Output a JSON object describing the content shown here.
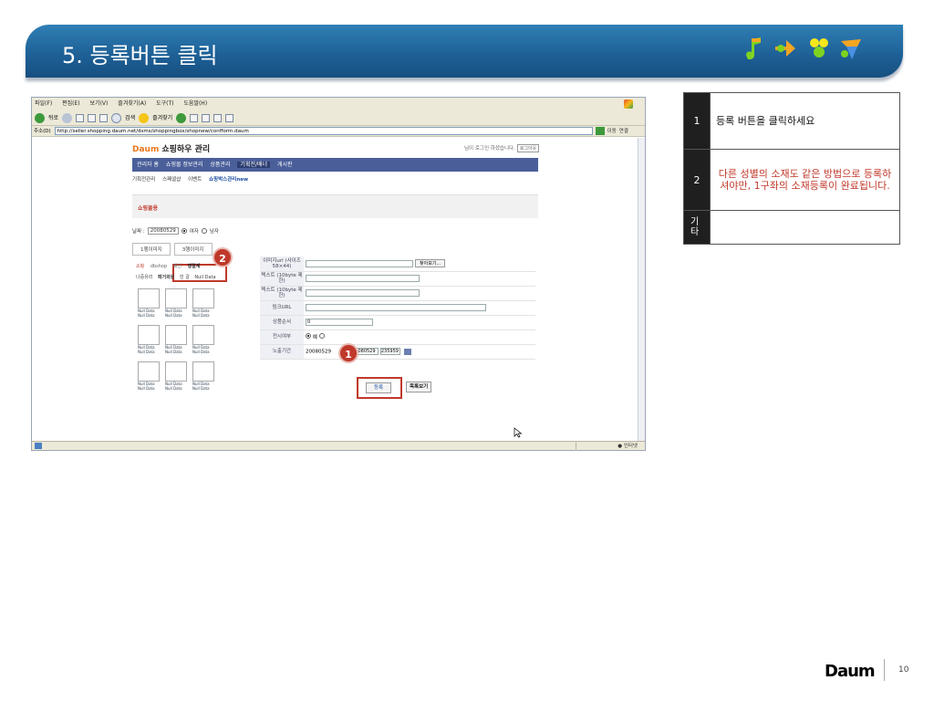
{
  "slide": {
    "title": "5. 등록버튼 클릭",
    "page_number": "10",
    "footer_logo": "Daum"
  },
  "browser": {
    "menu": [
      "파일(F)",
      "편집(E)",
      "보기(V)",
      "즐겨찾기(A)",
      "도구(T)",
      "도움말(H)"
    ],
    "toolbar": {
      "back": "뒤로",
      "search": "검색",
      "favorites": "즐겨찾기"
    },
    "address_label": "주소(D)",
    "url": "http://seller.shopping.daum.net/dsms/shoppingbox/shopnew/confform.daum",
    "go_label": "이동",
    "links_label": "연결",
    "status_text": "인터넷"
  },
  "page": {
    "logo_mark": "Daum",
    "logo_text": "쇼핑하우 관리",
    "login_info": "님이 로그인 하셨습니다.",
    "logout": "로그아웃",
    "nav": [
      "관리자 홈",
      "쇼핑몰 정보관리",
      "상품관리",
      "기획전/배너",
      "게시판"
    ],
    "nav_active_index": 3,
    "subnav": [
      "기획전관리",
      "스페셜샵",
      "이벤트",
      "쇼핑박스관리new"
    ],
    "section_title": "쇼핑몰용",
    "date_label": "날짜 :",
    "date_value": "20080529",
    "female": "여자",
    "male": "남자",
    "img_tabs": [
      "1행이미지",
      "3행이미지"
    ],
    "categories": [
      "쇼핑",
      "dbshop",
      "패션",
      "행렬계"
    ],
    "cat_row2": [
      "나중유리",
      "패거화원",
      "빈 갈",
      "Null Data"
    ],
    "thumb_caption": "Null Data",
    "form": {
      "image_url_label": "이미지url (사이즈 58×44)",
      "find_button": "찾아보기...",
      "text1_label": "텍스트 (10byte 제한)",
      "text2_label": "텍스트 (10byte 제한)",
      "link_label": "링크URL",
      "order_label": "상품순서",
      "order_value": "0",
      "display_label": "전시여부",
      "display_yes": "예",
      "period_label": "노출기간",
      "period_start": "20080529",
      "period_end": "20080529",
      "period_time": "235959"
    },
    "register_button": "등록",
    "list_button": "목록보기"
  },
  "badges": {
    "b1": "1",
    "b2": "2"
  },
  "instructions": [
    {
      "num": "1",
      "text": "등록 버튼을 클릭하세요"
    },
    {
      "num": "2",
      "text": "다른 성별의 소재도 같은 방법으로 등록하셔야만, 1구좌의 소재등록이 완료됩니다."
    },
    {
      "num": "기타",
      "text": ""
    }
  ],
  "colors": {
    "header": "#1d5f95",
    "highlight": "#c0392b",
    "nav": "#4a5f9a"
  }
}
